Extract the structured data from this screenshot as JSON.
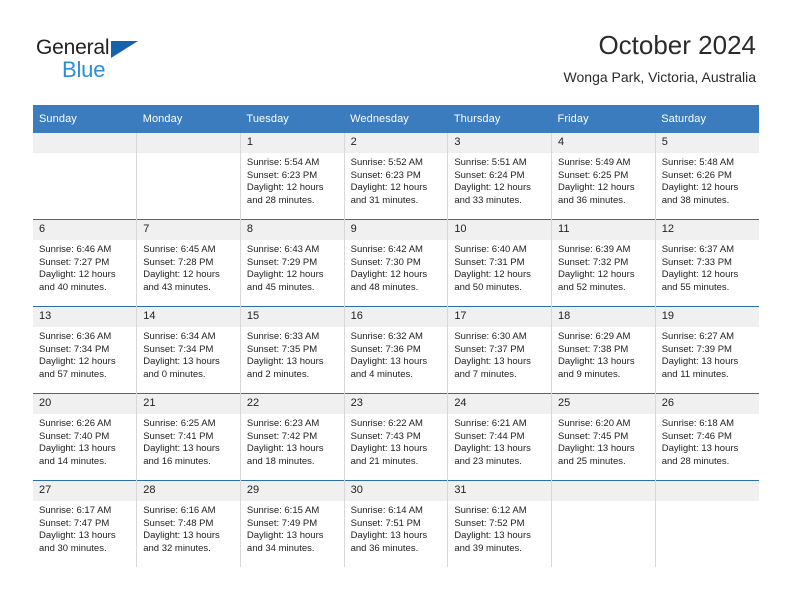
{
  "brand": {
    "name_top": "General",
    "name_bottom": "Blue",
    "accent_dark": "#1462ab",
    "accent_light": "#2d8dd6"
  },
  "header": {
    "title": "October 2024",
    "subtitle": "Wonga Park, Victoria, Australia"
  },
  "calendar": {
    "header_color": "#3a7cbe",
    "weekdays": [
      "Sunday",
      "Monday",
      "Tuesday",
      "Wednesday",
      "Thursday",
      "Friday",
      "Saturday"
    ],
    "labels": {
      "sunrise": "Sunrise:",
      "sunset": "Sunset:",
      "daylight": "Daylight:"
    },
    "weeks": [
      [
        {
          "day": "",
          "sunrise": "",
          "sunset": "",
          "daylight": ""
        },
        {
          "day": "",
          "sunrise": "",
          "sunset": "",
          "daylight": ""
        },
        {
          "day": "1",
          "sunrise": "Sunrise: 5:54 AM",
          "sunset": "Sunset: 6:23 PM",
          "daylight": "Daylight: 12 hours and 28 minutes."
        },
        {
          "day": "2",
          "sunrise": "Sunrise: 5:52 AM",
          "sunset": "Sunset: 6:23 PM",
          "daylight": "Daylight: 12 hours and 31 minutes."
        },
        {
          "day": "3",
          "sunrise": "Sunrise: 5:51 AM",
          "sunset": "Sunset: 6:24 PM",
          "daylight": "Daylight: 12 hours and 33 minutes."
        },
        {
          "day": "4",
          "sunrise": "Sunrise: 5:49 AM",
          "sunset": "Sunset: 6:25 PM",
          "daylight": "Daylight: 12 hours and 36 minutes."
        },
        {
          "day": "5",
          "sunrise": "Sunrise: 5:48 AM",
          "sunset": "Sunset: 6:26 PM",
          "daylight": "Daylight: 12 hours and 38 minutes."
        }
      ],
      [
        {
          "day": "6",
          "sunrise": "Sunrise: 6:46 AM",
          "sunset": "Sunset: 7:27 PM",
          "daylight": "Daylight: 12 hours and 40 minutes."
        },
        {
          "day": "7",
          "sunrise": "Sunrise: 6:45 AM",
          "sunset": "Sunset: 7:28 PM",
          "daylight": "Daylight: 12 hours and 43 minutes."
        },
        {
          "day": "8",
          "sunrise": "Sunrise: 6:43 AM",
          "sunset": "Sunset: 7:29 PM",
          "daylight": "Daylight: 12 hours and 45 minutes."
        },
        {
          "day": "9",
          "sunrise": "Sunrise: 6:42 AM",
          "sunset": "Sunset: 7:30 PM",
          "daylight": "Daylight: 12 hours and 48 minutes."
        },
        {
          "day": "10",
          "sunrise": "Sunrise: 6:40 AM",
          "sunset": "Sunset: 7:31 PM",
          "daylight": "Daylight: 12 hours and 50 minutes."
        },
        {
          "day": "11",
          "sunrise": "Sunrise: 6:39 AM",
          "sunset": "Sunset: 7:32 PM",
          "daylight": "Daylight: 12 hours and 52 minutes."
        },
        {
          "day": "12",
          "sunrise": "Sunrise: 6:37 AM",
          "sunset": "Sunset: 7:33 PM",
          "daylight": "Daylight: 12 hours and 55 minutes."
        }
      ],
      [
        {
          "day": "13",
          "sunrise": "Sunrise: 6:36 AM",
          "sunset": "Sunset: 7:34 PM",
          "daylight": "Daylight: 12 hours and 57 minutes."
        },
        {
          "day": "14",
          "sunrise": "Sunrise: 6:34 AM",
          "sunset": "Sunset: 7:34 PM",
          "daylight": "Daylight: 13 hours and 0 minutes."
        },
        {
          "day": "15",
          "sunrise": "Sunrise: 6:33 AM",
          "sunset": "Sunset: 7:35 PM",
          "daylight": "Daylight: 13 hours and 2 minutes."
        },
        {
          "day": "16",
          "sunrise": "Sunrise: 6:32 AM",
          "sunset": "Sunset: 7:36 PM",
          "daylight": "Daylight: 13 hours and 4 minutes."
        },
        {
          "day": "17",
          "sunrise": "Sunrise: 6:30 AM",
          "sunset": "Sunset: 7:37 PM",
          "daylight": "Daylight: 13 hours and 7 minutes."
        },
        {
          "day": "18",
          "sunrise": "Sunrise: 6:29 AM",
          "sunset": "Sunset: 7:38 PM",
          "daylight": "Daylight: 13 hours and 9 minutes."
        },
        {
          "day": "19",
          "sunrise": "Sunrise: 6:27 AM",
          "sunset": "Sunset: 7:39 PM",
          "daylight": "Daylight: 13 hours and 11 minutes."
        }
      ],
      [
        {
          "day": "20",
          "sunrise": "Sunrise: 6:26 AM",
          "sunset": "Sunset: 7:40 PM",
          "daylight": "Daylight: 13 hours and 14 minutes."
        },
        {
          "day": "21",
          "sunrise": "Sunrise: 6:25 AM",
          "sunset": "Sunset: 7:41 PM",
          "daylight": "Daylight: 13 hours and 16 minutes."
        },
        {
          "day": "22",
          "sunrise": "Sunrise: 6:23 AM",
          "sunset": "Sunset: 7:42 PM",
          "daylight": "Daylight: 13 hours and 18 minutes."
        },
        {
          "day": "23",
          "sunrise": "Sunrise: 6:22 AM",
          "sunset": "Sunset: 7:43 PM",
          "daylight": "Daylight: 13 hours and 21 minutes."
        },
        {
          "day": "24",
          "sunrise": "Sunrise: 6:21 AM",
          "sunset": "Sunset: 7:44 PM",
          "daylight": "Daylight: 13 hours and 23 minutes."
        },
        {
          "day": "25",
          "sunrise": "Sunrise: 6:20 AM",
          "sunset": "Sunset: 7:45 PM",
          "daylight": "Daylight: 13 hours and 25 minutes."
        },
        {
          "day": "26",
          "sunrise": "Sunrise: 6:18 AM",
          "sunset": "Sunset: 7:46 PM",
          "daylight": "Daylight: 13 hours and 28 minutes."
        }
      ],
      [
        {
          "day": "27",
          "sunrise": "Sunrise: 6:17 AM",
          "sunset": "Sunset: 7:47 PM",
          "daylight": "Daylight: 13 hours and 30 minutes."
        },
        {
          "day": "28",
          "sunrise": "Sunrise: 6:16 AM",
          "sunset": "Sunset: 7:48 PM",
          "daylight": "Daylight: 13 hours and 32 minutes."
        },
        {
          "day": "29",
          "sunrise": "Sunrise: 6:15 AM",
          "sunset": "Sunset: 7:49 PM",
          "daylight": "Daylight: 13 hours and 34 minutes."
        },
        {
          "day": "30",
          "sunrise": "Sunrise: 6:14 AM",
          "sunset": "Sunset: 7:51 PM",
          "daylight": "Daylight: 13 hours and 36 minutes."
        },
        {
          "day": "31",
          "sunrise": "Sunrise: 6:12 AM",
          "sunset": "Sunset: 7:52 PM",
          "daylight": "Daylight: 13 hours and 39 minutes."
        },
        {
          "day": "",
          "sunrise": "",
          "sunset": "",
          "daylight": ""
        },
        {
          "day": "",
          "sunrise": "",
          "sunset": "",
          "daylight": ""
        }
      ]
    ]
  }
}
